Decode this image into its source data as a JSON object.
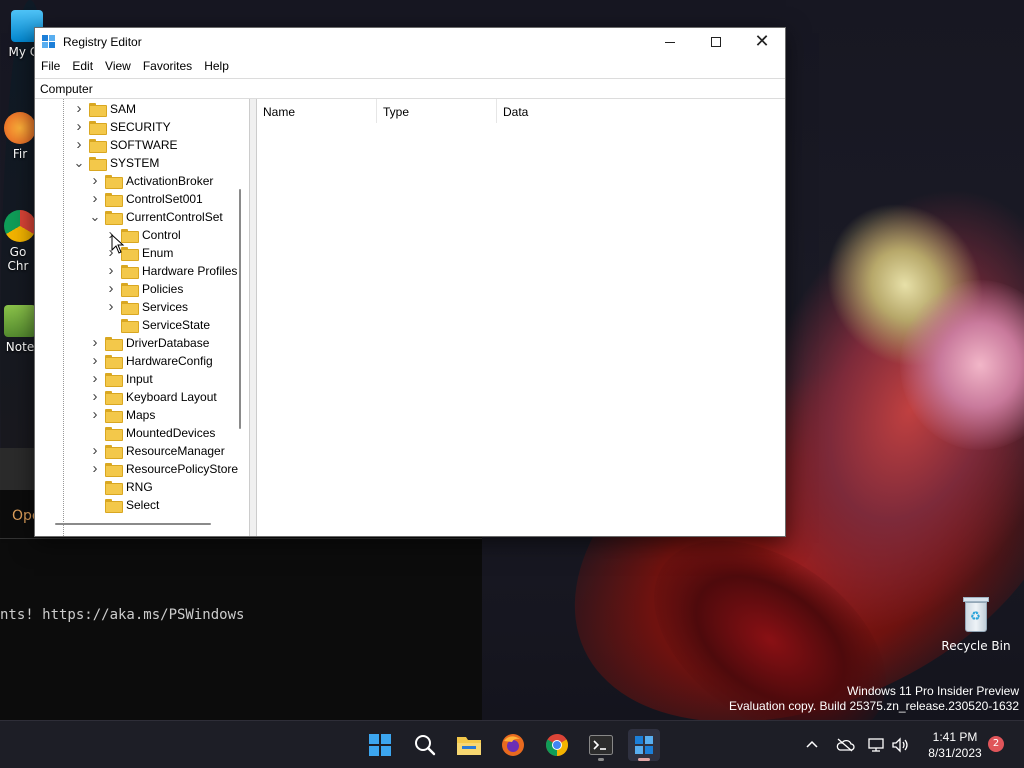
{
  "desktop": {
    "icons": [
      {
        "label": "My Co"
      },
      {
        "label": "Fir"
      },
      {
        "label": "Go Chr"
      },
      {
        "label": "Note"
      }
    ],
    "recycle_bin": {
      "label": "Recycle Bin"
    },
    "watermark": {
      "line1": "Windows 11 Pro Insider Preview",
      "line2": "Evaluation copy. Build 25375.zn_release.230520-1632"
    }
  },
  "terminal": {
    "open_hint": "Ope",
    "text_line": "nts! https://aka.ms/PSWindows"
  },
  "window": {
    "title": "Registry Editor",
    "menu": [
      "File",
      "Edit",
      "View",
      "Favorites",
      "Help"
    ],
    "address": "Computer",
    "tree": [
      {
        "label": "SAM",
        "expander": "collapsed"
      },
      {
        "label": "SECURITY",
        "expander": "collapsed"
      },
      {
        "label": "SOFTWARE",
        "expander": "collapsed"
      },
      {
        "label": "SYSTEM",
        "expander": "expanded"
      },
      {
        "label": "ActivationBroker",
        "expander": "collapsed"
      },
      {
        "label": "ControlSet001",
        "expander": "collapsed"
      },
      {
        "label": "CurrentControlSet",
        "expander": "expanded"
      },
      {
        "label": "Control",
        "expander": "collapsed"
      },
      {
        "label": "Enum",
        "expander": "collapsed"
      },
      {
        "label": "Hardware Profiles",
        "expander": "collapsed"
      },
      {
        "label": "Policies",
        "expander": "collapsed"
      },
      {
        "label": "Services",
        "expander": "collapsed"
      },
      {
        "label": "ServiceState",
        "expander": "none"
      },
      {
        "label": "DriverDatabase",
        "expander": "collapsed"
      },
      {
        "label": "HardwareConfig",
        "expander": "collapsed"
      },
      {
        "label": "Input",
        "expander": "collapsed"
      },
      {
        "label": "Keyboard Layout",
        "expander": "collapsed"
      },
      {
        "label": "Maps",
        "expander": "collapsed"
      },
      {
        "label": "MountedDevices",
        "expander": "none"
      },
      {
        "label": "ResourceManager",
        "expander": "collapsed"
      },
      {
        "label": "ResourcePolicyStore",
        "expander": "collapsed"
      },
      {
        "label": "RNG",
        "expander": "none"
      },
      {
        "label": "Select",
        "expander": "none"
      }
    ],
    "columns": [
      "Name",
      "Type",
      "Data"
    ]
  },
  "taskbar": {
    "apps": [
      "start-icon",
      "search-icon",
      "file-explorer-icon",
      "firefox-icon",
      "chrome-icon",
      "terminal-icon",
      "registry-editor-icon"
    ],
    "clock": {
      "time": "1:41 PM",
      "date": "8/31/2023"
    },
    "notification_count": "2",
    "colors": {
      "accent": "#3ca6f0",
      "badge": "#e0555a"
    }
  }
}
